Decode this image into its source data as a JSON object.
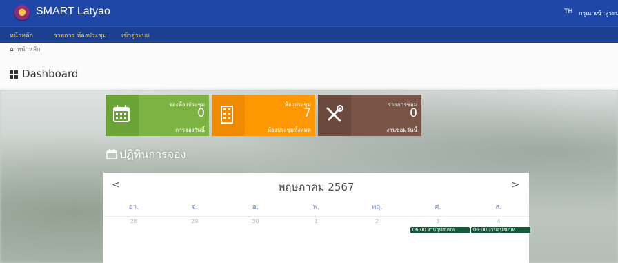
{
  "header": {
    "brand": "SMART Latyao",
    "lang": "TH",
    "login_note": "กรุณาเข้าสู่ระบ"
  },
  "nav": [
    {
      "label": "หน้าหลัก"
    },
    {
      "label": "รายการ ห้องประชุม"
    },
    {
      "label": "เข้าสู่ระบบ"
    }
  ],
  "breadcrumb": {
    "label": "หน้าหลัก"
  },
  "page": {
    "title": "Dashboard"
  },
  "cards": {
    "booking": {
      "title": "จองห้องประชุม",
      "value": "0",
      "sub": "การจองวันนี้",
      "color": "#7cb342"
    },
    "rooms": {
      "title": "ห้องประชุม",
      "value": "7",
      "sub": "ห้องประชุมทั้งหมด",
      "color": "#ff9800"
    },
    "repairs": {
      "title": "รายการซ่อม",
      "value": "0",
      "sub": "งานซ่อมวันนี้",
      "color": "#795548"
    }
  },
  "calendar": {
    "section_title": "ปฏิทินการจอง",
    "month_title": "พฤษภาคม 2567",
    "prev": "<",
    "next": ">",
    "weekdays": [
      "อา.",
      "จ.",
      "อ.",
      "พ.",
      "พฤ.",
      "ศ.",
      "ส."
    ],
    "days": [
      "28",
      "29",
      "30",
      "1",
      "2",
      "3",
      "4"
    ],
    "events": {
      "fri": "06:00 งานอุปสมบท",
      "sat": "06:00 งานอุปสมบท"
    },
    "event_color": "#0f5a3a"
  },
  "colors": {
    "header": "#1f47a8",
    "nav": "#1c3f8f",
    "nav_text": "#ffd23a"
  }
}
